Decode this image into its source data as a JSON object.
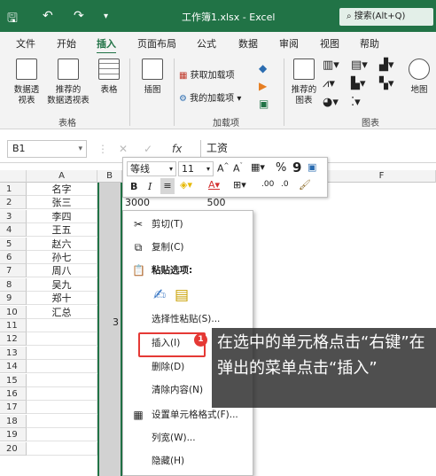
{
  "window": {
    "title": "工作簿1.xlsx - Excel",
    "search_placeholder": "搜索(Alt+Q)"
  },
  "tabs": [
    "文件",
    "开始",
    "插入",
    "页面布局",
    "公式",
    "数据",
    "审阅",
    "视图",
    "帮助"
  ],
  "active_tab": "插入",
  "ribbon": {
    "pivot_label_1": "数据透",
    "pivot_label_2": "视表",
    "rec_pivot_1": "推荐的",
    "rec_pivot_2": "数据透视表",
    "table_label": "表格",
    "group_tables": "表格",
    "illustration_label": "插图",
    "get_addins": "获取加载项",
    "my_addins": "我的加载项",
    "group_addins": "加载项",
    "rec_chart_1": "推荐的",
    "rec_chart_2": "图表",
    "group_charts": "图表",
    "map_label": "地图"
  },
  "formula_bar": {
    "name_box": "B1",
    "fx": "fx",
    "value": "工资"
  },
  "columns": [
    "A",
    "B",
    "C",
    "D",
    "E",
    "F"
  ],
  "rows": [
    "1",
    "2",
    "3",
    "4",
    "5",
    "6",
    "7",
    "8",
    "9",
    "10",
    "11",
    "12",
    "13",
    "14",
    "15",
    "16",
    "17",
    "18",
    "19",
    "20"
  ],
  "column_a": [
    "名字",
    "张三",
    "李四",
    "王五",
    "赵六",
    "孙七",
    "周八",
    "吴九",
    "郑十",
    "汇总"
  ],
  "row2_values": {
    "c": "3000",
    "d": "500"
  },
  "partial_cell": "3",
  "mini_toolbar": {
    "font": "等线",
    "size": "11",
    "grow": "A",
    "shrink": "A",
    "percent": "%",
    "comma": "9",
    "bold": "B",
    "italic": "I"
  },
  "context_menu": {
    "cut": "剪切(T)",
    "copy": "复制(C)",
    "paste_options": "粘贴选项:",
    "paste_special": "选择性粘贴(S)...",
    "insert": "插入(I)",
    "delete": "删除(D)",
    "clear": "清除内容(N)",
    "format_cells": "设置单元格格式(F)...",
    "column_width": "列宽(W)...",
    "hide": "隐藏(H)"
  },
  "step_badge": "1",
  "annotation": "在选中的单元格点击“右键”在弹出的菜单点击“插入”",
  "colors": {
    "excel_green": "#217346",
    "highlight_red": "#e53935"
  }
}
